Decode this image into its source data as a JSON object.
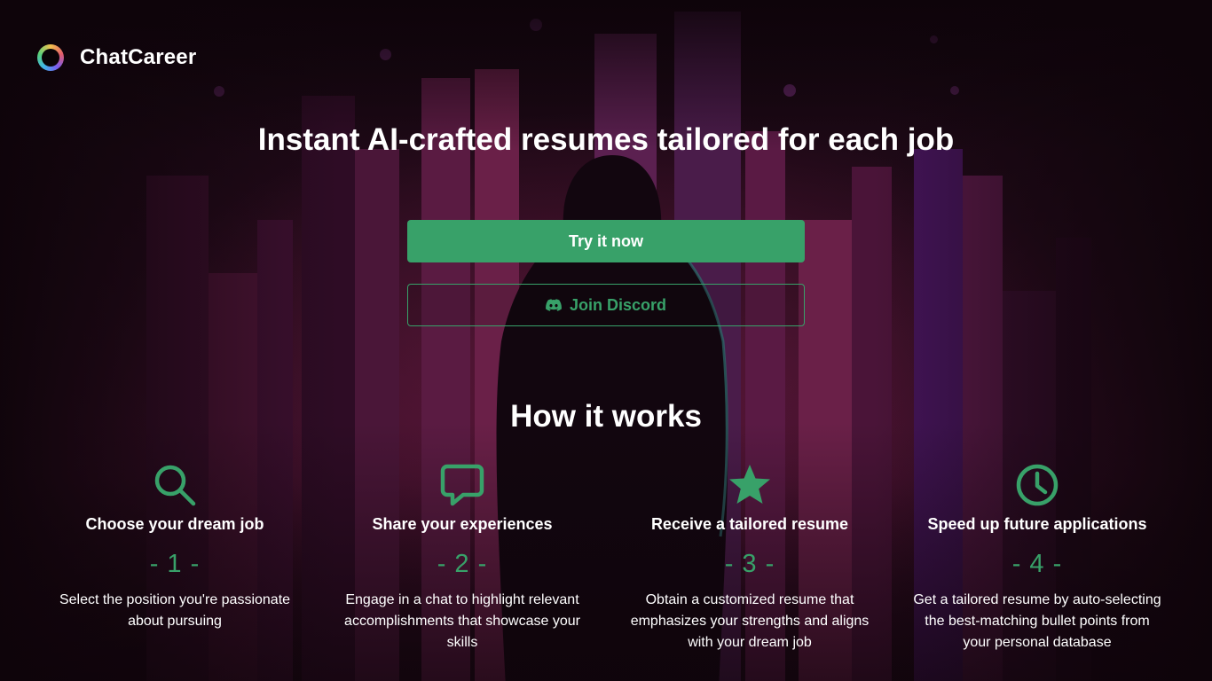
{
  "header": {
    "logo_icon": "chatcareer-logo-icon",
    "brand": "ChatCareer"
  },
  "hero": {
    "title": "Instant AI-crafted resumes tailored for each job",
    "primary_button": "Try it now",
    "secondary_button": "Join Discord",
    "secondary_icon": "discord-icon"
  },
  "how": {
    "title": "How it works",
    "steps": [
      {
        "icon": "search-icon",
        "title": "Choose your dream job",
        "number": "- 1 -",
        "desc": "Select the position you're passionate about pursuing"
      },
      {
        "icon": "chat-bubble-icon",
        "title": "Share your experiences",
        "number": "- 2 -",
        "desc": "Engage in a chat to highlight relevant accomplishments that showcase your skills"
      },
      {
        "icon": "star-icon",
        "title": "Receive a tailored resume",
        "number": "- 3 -",
        "desc": "Obtain a customized resume that emphasizes your strengths and aligns with your dream job"
      },
      {
        "icon": "clock-icon",
        "title": "Speed up future applications",
        "number": "- 4 -",
        "desc": "Get a tailored resume by auto-selecting the best-matching bullet points from your personal database"
      }
    ]
  },
  "colors": {
    "accent": "#38a169",
    "background": "#140710",
    "text": "#ffffff"
  }
}
